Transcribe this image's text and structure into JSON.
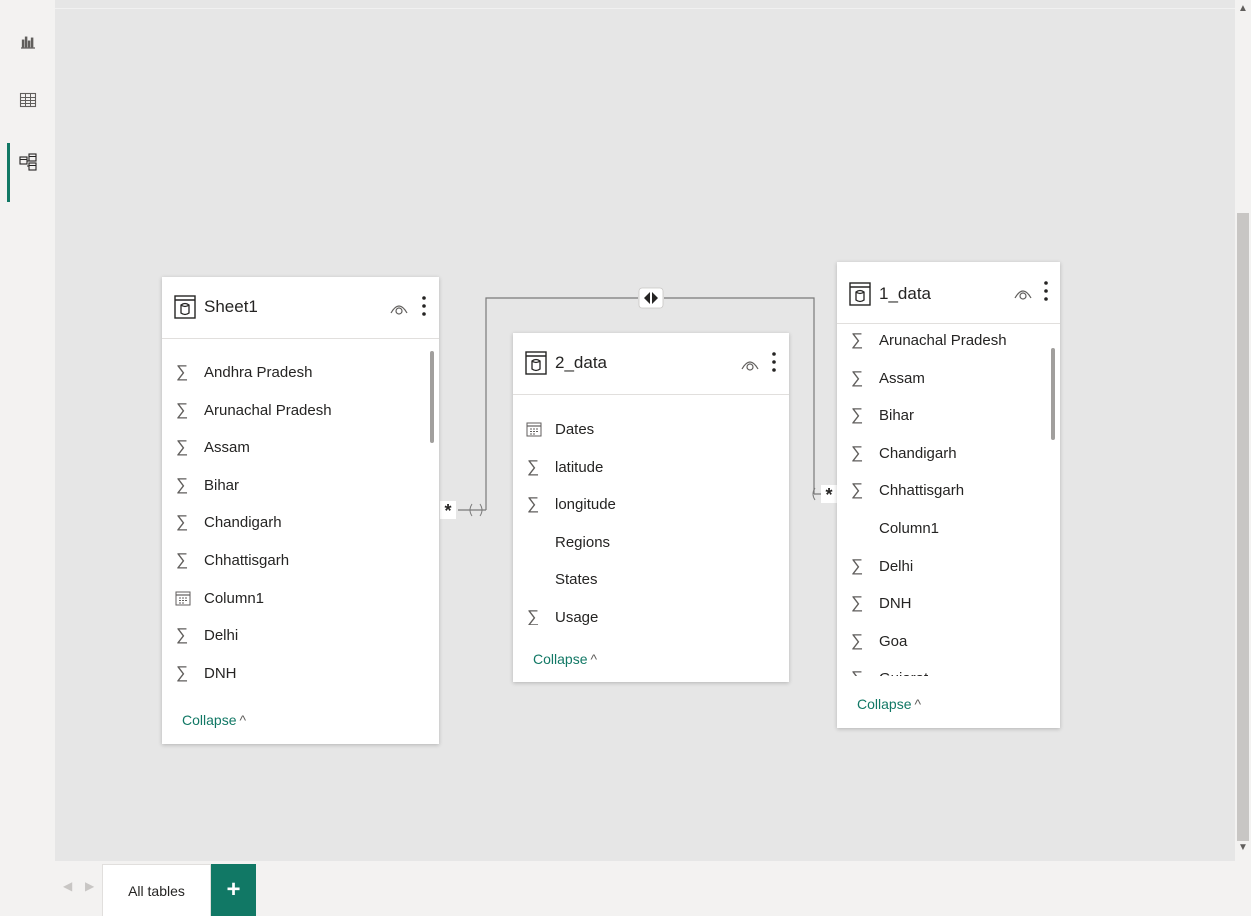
{
  "rail": {
    "items": [
      {
        "name": "report-view",
        "icon": "bar-chart-icon"
      },
      {
        "name": "table-view",
        "icon": "grid-icon"
      },
      {
        "name": "model-view",
        "icon": "model-icon",
        "active": true
      }
    ]
  },
  "tables": {
    "sheet1": {
      "title": "Sheet1",
      "fields": [
        {
          "label": "Andhra Pradesh",
          "type": "sum"
        },
        {
          "label": "Arunachal Pradesh",
          "type": "sum"
        },
        {
          "label": "Assam",
          "type": "sum"
        },
        {
          "label": "Bihar",
          "type": "sum"
        },
        {
          "label": "Chandigarh",
          "type": "sum"
        },
        {
          "label": "Chhattisgarh",
          "type": "sum"
        },
        {
          "label": "Column1",
          "type": "date"
        },
        {
          "label": "Delhi",
          "type": "sum"
        },
        {
          "label": "DNH",
          "type": "sum"
        }
      ],
      "collapse_label": "Collapse"
    },
    "data2": {
      "title": "2_data",
      "fields": [
        {
          "label": "Dates",
          "type": "date"
        },
        {
          "label": "latitude",
          "type": "sum"
        },
        {
          "label": "longitude",
          "type": "sum"
        },
        {
          "label": "Regions",
          "type": "text"
        },
        {
          "label": "States",
          "type": "text"
        },
        {
          "label": "Usage",
          "type": "sum"
        }
      ],
      "collapse_label": "Collapse"
    },
    "data1": {
      "title": "1_data",
      "fields": [
        {
          "label": "Arunachal Pradesh",
          "type": "sum"
        },
        {
          "label": "Assam",
          "type": "sum"
        },
        {
          "label": "Bihar",
          "type": "sum"
        },
        {
          "label": "Chandigarh",
          "type": "sum"
        },
        {
          "label": "Chhattisgarh",
          "type": "sum"
        },
        {
          "label": "Column1",
          "type": "text"
        },
        {
          "label": "Delhi",
          "type": "sum"
        },
        {
          "label": "DNH",
          "type": "sum"
        },
        {
          "label": "Goa",
          "type": "sum"
        },
        {
          "label": "Gujarat",
          "type": "sum"
        }
      ],
      "collapse_label": "Collapse"
    }
  },
  "relationships": {
    "many_symbol": "*",
    "bidirectional_icon": "bidirectional-arrow-icon"
  },
  "tabs": {
    "active_label": "All tables",
    "add_label": "+"
  },
  "colors": {
    "accent": "#117865",
    "canvas": "#e6e6e6"
  }
}
